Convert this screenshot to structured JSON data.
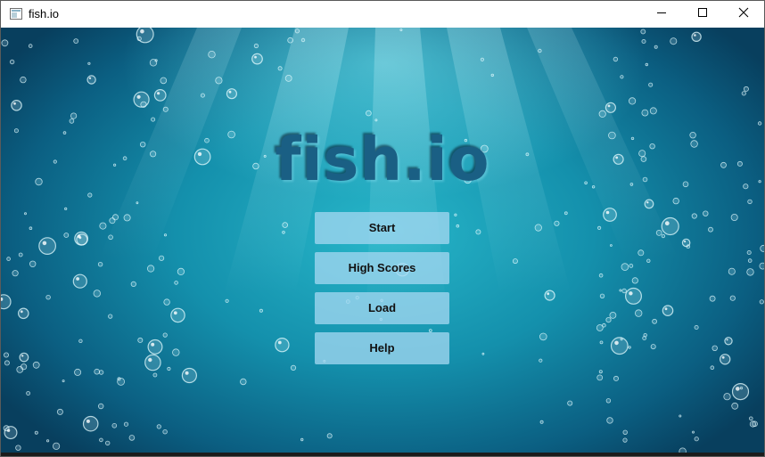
{
  "window": {
    "title": "fish.io",
    "app_icon": "window-app-icon",
    "controls": {
      "minimize_icon": "minimize-icon",
      "maximize_icon": "maximize-icon",
      "close_icon": "close-icon"
    }
  },
  "game": {
    "logo": "fish.io",
    "menu": {
      "start_label": "Start",
      "high_scores_label": "High Scores",
      "load_label": "Load",
      "help_label": "Help"
    }
  },
  "colors": {
    "water_light": "#27b6c9",
    "water_dark": "#083f5e",
    "logo": "#1a5f84",
    "button_bg": "#a0d6f0"
  }
}
